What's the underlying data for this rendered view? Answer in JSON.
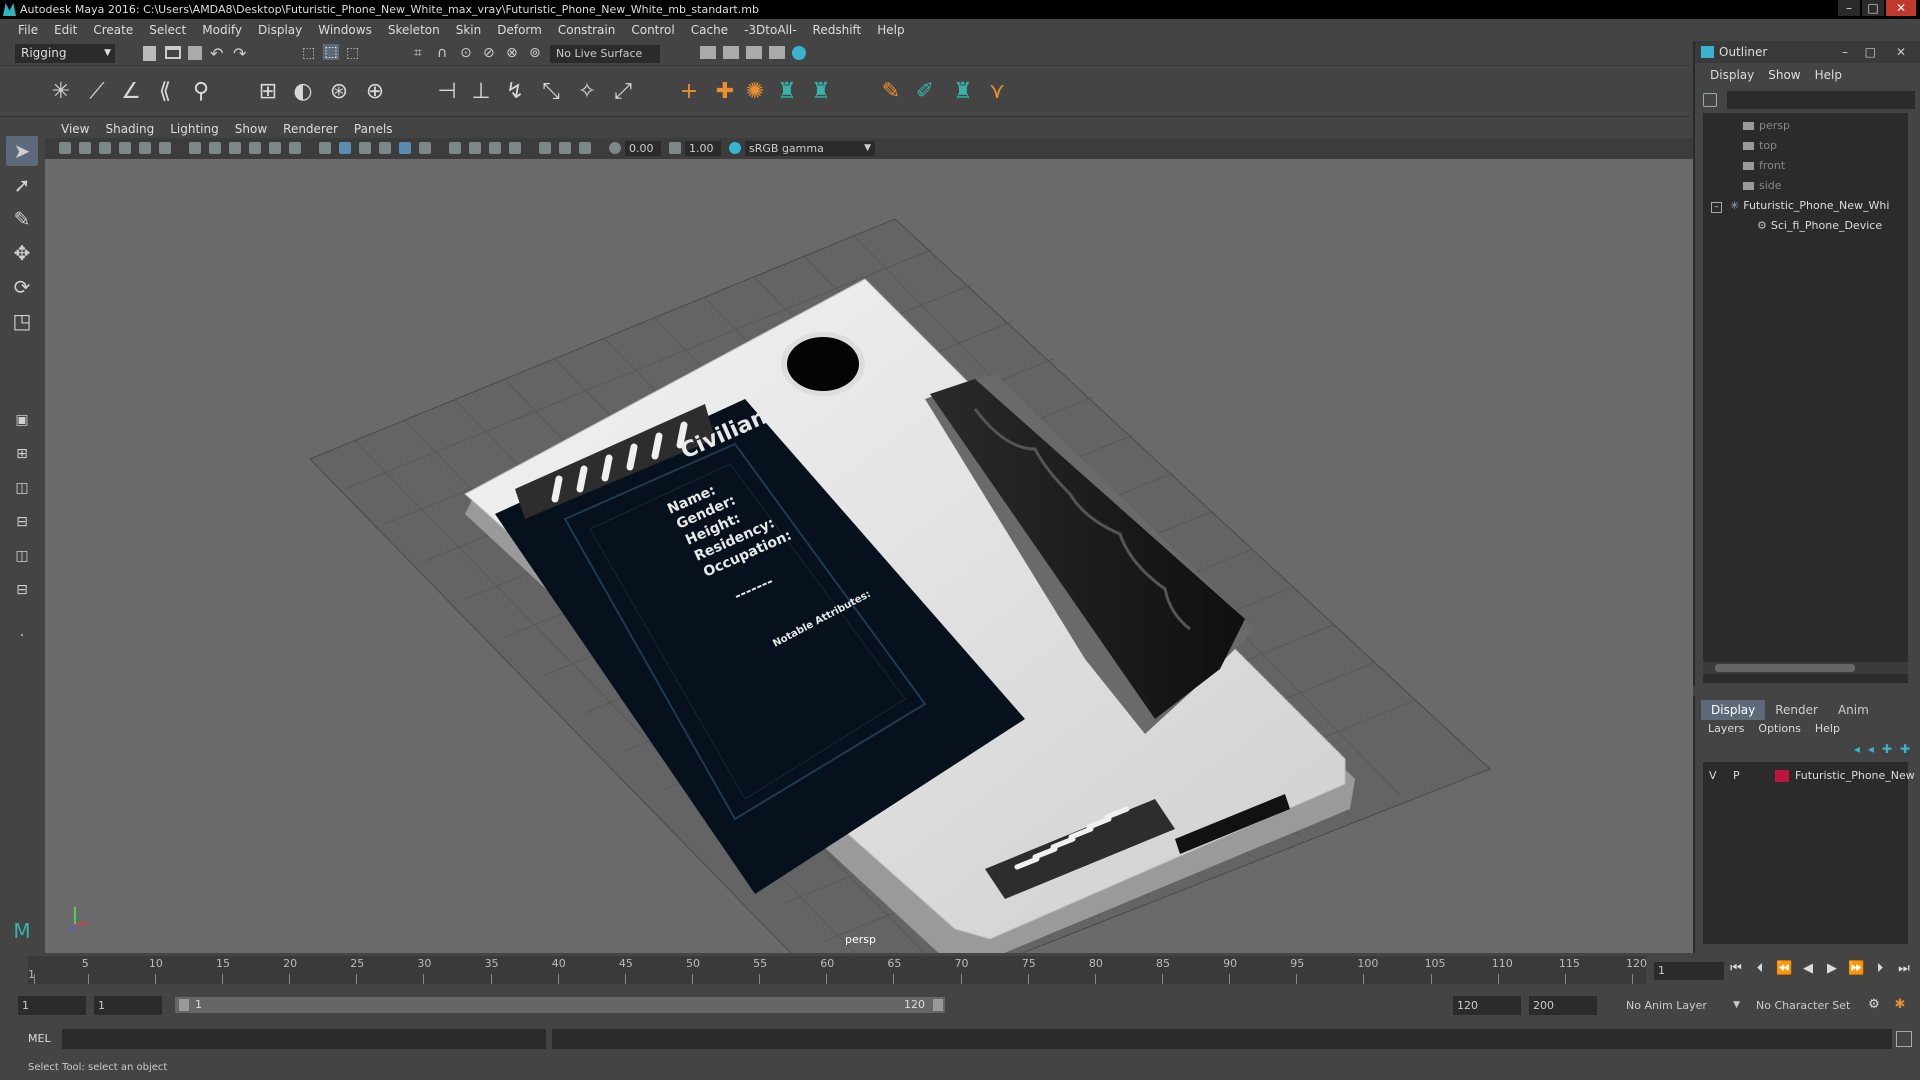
{
  "window": {
    "title": "Autodesk Maya 2016: C:\\Users\\AMDA8\\Desktop\\Futuristic_Phone_New_White_max_vray\\Futuristic_Phone_New_White_mb_standart.mb"
  },
  "menubar": [
    "File",
    "Edit",
    "Create",
    "Select",
    "Modify",
    "Display",
    "Windows",
    "Skeleton",
    "Skin",
    "Deform",
    "Constrain",
    "Control",
    "Cache",
    "-3DtoAll-",
    "Redshift",
    "Help"
  ],
  "toolbar": {
    "mode": "Rigging",
    "live_surface": "No Live Surface"
  },
  "viewport": {
    "menu": [
      "View",
      "Shading",
      "Lighting",
      "Show",
      "Renderer",
      "Panels"
    ],
    "exposure": "0.00",
    "gamma": "1.00",
    "color_space": "sRGB gamma",
    "camera": "persp"
  },
  "model_screen": {
    "heading": "Civilian",
    "fields": [
      "Name:",
      "Gender:",
      "Height:",
      "Residency:",
      "Occupation:"
    ],
    "dashes": "-------",
    "notable": "Notable Attributes:"
  },
  "outliner": {
    "title": "Outliner",
    "menu": [
      "Display",
      "Show",
      "Help"
    ],
    "items": [
      {
        "label": "persp",
        "dim": true
      },
      {
        "label": "top",
        "dim": true
      },
      {
        "label": "front",
        "dim": true
      },
      {
        "label": "side",
        "dim": true
      },
      {
        "label": "Futuristic_Phone_New_Whi",
        "dim": false
      },
      {
        "label": "Sci_fi_Phone_Device",
        "dim": false
      }
    ]
  },
  "layers": {
    "tabs": [
      "Display",
      "Render",
      "Anim"
    ],
    "menu": [
      "Layers",
      "Options",
      "Help"
    ],
    "row": {
      "v": "V",
      "p": "P",
      "name": "Futuristic_Phone_New",
      "color": "#c0143c"
    }
  },
  "timeline": {
    "ticks": [
      "1",
      "5",
      "10",
      "15",
      "20",
      "25",
      "30",
      "35",
      "40",
      "45",
      "50",
      "55",
      "60",
      "65",
      "70",
      "75",
      "80",
      "85",
      "90",
      "95",
      "100",
      "105",
      "110",
      "115",
      "120"
    ],
    "current_frame": "1"
  },
  "range": {
    "start": "1",
    "start2": "1",
    "slider_start": "1",
    "slider_end": "120",
    "end": "120",
    "end2": "200",
    "anim_layer": "No Anim Layer",
    "char_set": "No Character Set"
  },
  "cmdline": {
    "label": "MEL"
  },
  "status": {
    "text": "Select Tool: select an object"
  }
}
